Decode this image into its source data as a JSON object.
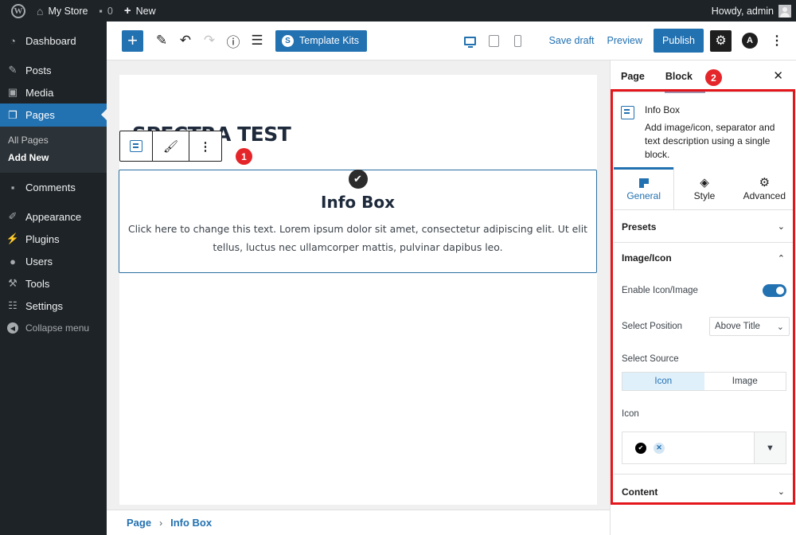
{
  "admin_bar": {
    "site_name": "My Store",
    "comments_count": "0",
    "new_label": "New",
    "greeting": "Howdy, admin"
  },
  "sidebar": {
    "items": [
      {
        "label": "Dashboard",
        "icon": "dashboard-icon"
      },
      {
        "label": "Posts",
        "icon": "pin-icon"
      },
      {
        "label": "Media",
        "icon": "media-icon"
      },
      {
        "label": "Pages",
        "icon": "pages-icon",
        "active": true
      },
      {
        "label": "Comments",
        "icon": "comment-icon"
      },
      {
        "label": "Appearance",
        "icon": "brush-icon"
      },
      {
        "label": "Plugins",
        "icon": "plug-icon"
      },
      {
        "label": "Users",
        "icon": "user-icon"
      },
      {
        "label": "Tools",
        "icon": "wrench-icon"
      },
      {
        "label": "Settings",
        "icon": "settings-sliders-icon"
      }
    ],
    "submenu": [
      "All Pages",
      "Add New"
    ],
    "collapse_label": "Collapse menu"
  },
  "toolbar": {
    "template_kits_label": "Template Kits",
    "save_draft_label": "Save draft",
    "preview_label": "Preview",
    "publish_label": "Publish",
    "active_device": "desktop"
  },
  "canvas": {
    "page_title": "SPECTRA TEST",
    "annotation_1": "1",
    "info_box": {
      "title": "Info Box",
      "description": "Click here to change this text. Lorem ipsum dolor sit amet, consectetur adipiscing elit. Ut elit tellus, luctus nec ullamcorper mattis, pulvinar dapibus leo."
    }
  },
  "breadcrumbs": [
    "Page",
    "Info Box"
  ],
  "panel": {
    "tabs": [
      "Page",
      "Block"
    ],
    "active_tab": "Block",
    "annotation_2": "2",
    "block_card": {
      "title": "Info Box",
      "description": "Add image/icon, separator and text description using a single block."
    },
    "settings_tabs": [
      "General",
      "Style",
      "Advanced"
    ],
    "active_settings_tab": "General",
    "sections": {
      "presets": "Presets",
      "image_icon": "Image/Icon",
      "content": "Content"
    },
    "enable_icon_label": "Enable Icon/Image",
    "enable_icon_value": true,
    "select_position_label": "Select Position",
    "select_position_value": "Above Title",
    "select_source_label": "Select Source",
    "source_options": [
      "Icon",
      "Image"
    ],
    "source_selected": "Icon",
    "icon_label": "Icon"
  },
  "colors": {
    "accent": "#2271b1",
    "admin_dark": "#1d2327",
    "annotation_red": "#e4161b"
  }
}
